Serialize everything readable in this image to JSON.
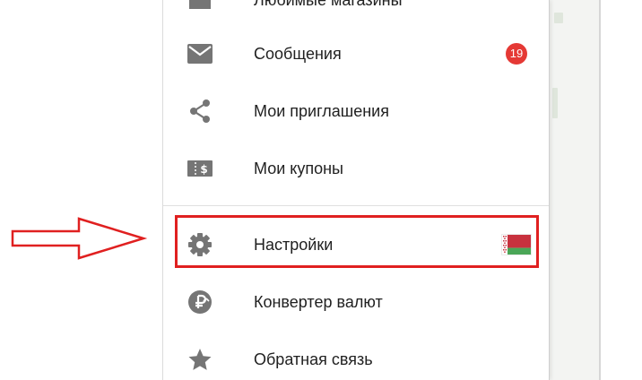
{
  "drawer": {
    "items": [
      {
        "label": "Любимые магазины",
        "icon": "store-icon"
      },
      {
        "label": "Сообщения",
        "icon": "mail-icon",
        "badge": "19"
      },
      {
        "label": "Мои приглашения",
        "icon": "share-icon"
      },
      {
        "label": "Мои купоны",
        "icon": "coupon-icon"
      },
      {
        "label": "Настройки",
        "icon": "gear-icon",
        "flag": "belarus-flag-icon",
        "highlighted": true
      },
      {
        "label": "Конвертер валют",
        "icon": "currency-converter-icon"
      },
      {
        "label": "Обратная связь",
        "icon": "star-icon"
      }
    ]
  },
  "colors": {
    "icon": "#757575",
    "text": "#212121",
    "badge": "#e53935",
    "highlight": "#e02020",
    "flag_red": "#c8313e",
    "flag_green": "#4aa657"
  }
}
